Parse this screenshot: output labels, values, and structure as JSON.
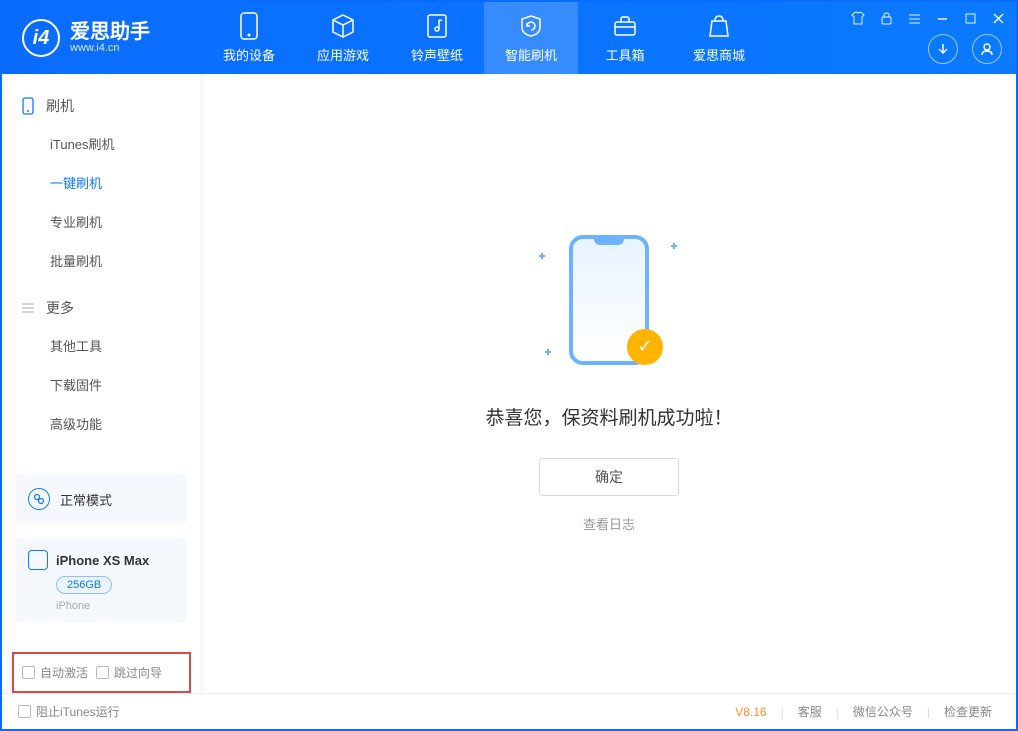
{
  "app": {
    "name": "爱思助手",
    "site": "www.i4.cn"
  },
  "tabs": [
    {
      "label": "我的设备"
    },
    {
      "label": "应用游戏"
    },
    {
      "label": "铃声壁纸"
    },
    {
      "label": "智能刷机"
    },
    {
      "label": "工具箱"
    },
    {
      "label": "爱思商城"
    }
  ],
  "sidebar": {
    "section1": {
      "title": "刷机",
      "items": [
        "iTunes刷机",
        "一键刷机",
        "专业刷机",
        "批量刷机"
      ]
    },
    "section2": {
      "title": "更多",
      "items": [
        "其他工具",
        "下载固件",
        "高级功能"
      ]
    },
    "mode": {
      "label": "正常模式"
    },
    "device": {
      "name": "iPhone XS Max",
      "capacity": "256GB",
      "type": "iPhone"
    },
    "checks": {
      "auto_activate": "自动激活",
      "skip_guide": "跳过向导"
    }
  },
  "main": {
    "success": "恭喜您，保资料刷机成功啦！",
    "ok": "确定",
    "view_log": "查看日志"
  },
  "statusbar": {
    "block_itunes": "阻止iTunes运行",
    "version": "V8.16",
    "support": "客服",
    "wechat": "微信公众号",
    "check_update": "检查更新"
  }
}
